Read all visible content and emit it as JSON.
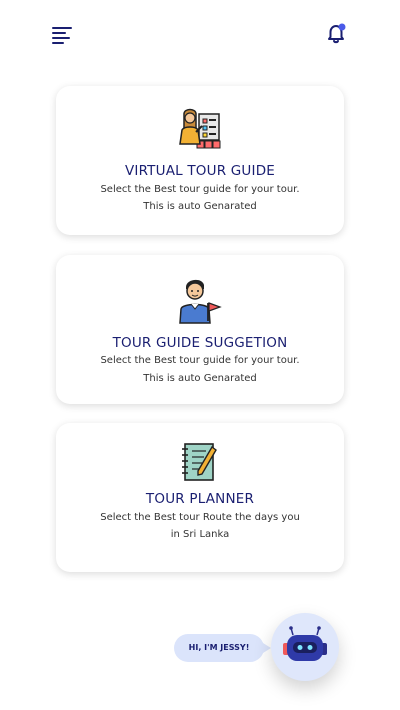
{
  "header": {
    "menu_icon": "hamburger-menu-icon",
    "notification_icon": "bell-icon",
    "notification_dot_color": "#4a5ae8"
  },
  "cards": [
    {
      "icon": "tour-guide-presenter-icon",
      "title": "VIRTUAL TOUR GUIDE",
      "description_line1": "Select the Best tour guide for your tour.",
      "description_line2": "This is auto Genarated"
    },
    {
      "icon": "guide-with-flag-icon",
      "title": "TOUR GUIDE SUGGETION",
      "description_line1": "Select the Best tour guide for your tour.",
      "description_line2": "This is auto Genarated"
    },
    {
      "icon": "notebook-pencil-icon",
      "title": "TOUR PLANNER",
      "description_line1": "Select the Best tour Route the days you",
      "description_line2": "in Sri Lanka"
    }
  ],
  "chatbot": {
    "greeting": "HI, I'M JESSY!",
    "icon": "robot-icon"
  },
  "colors": {
    "title": "#1a1f71",
    "card_bg": "#ffffff",
    "bot_bg": "#dfe7fb",
    "bubble_bg": "#dbe4fb"
  }
}
